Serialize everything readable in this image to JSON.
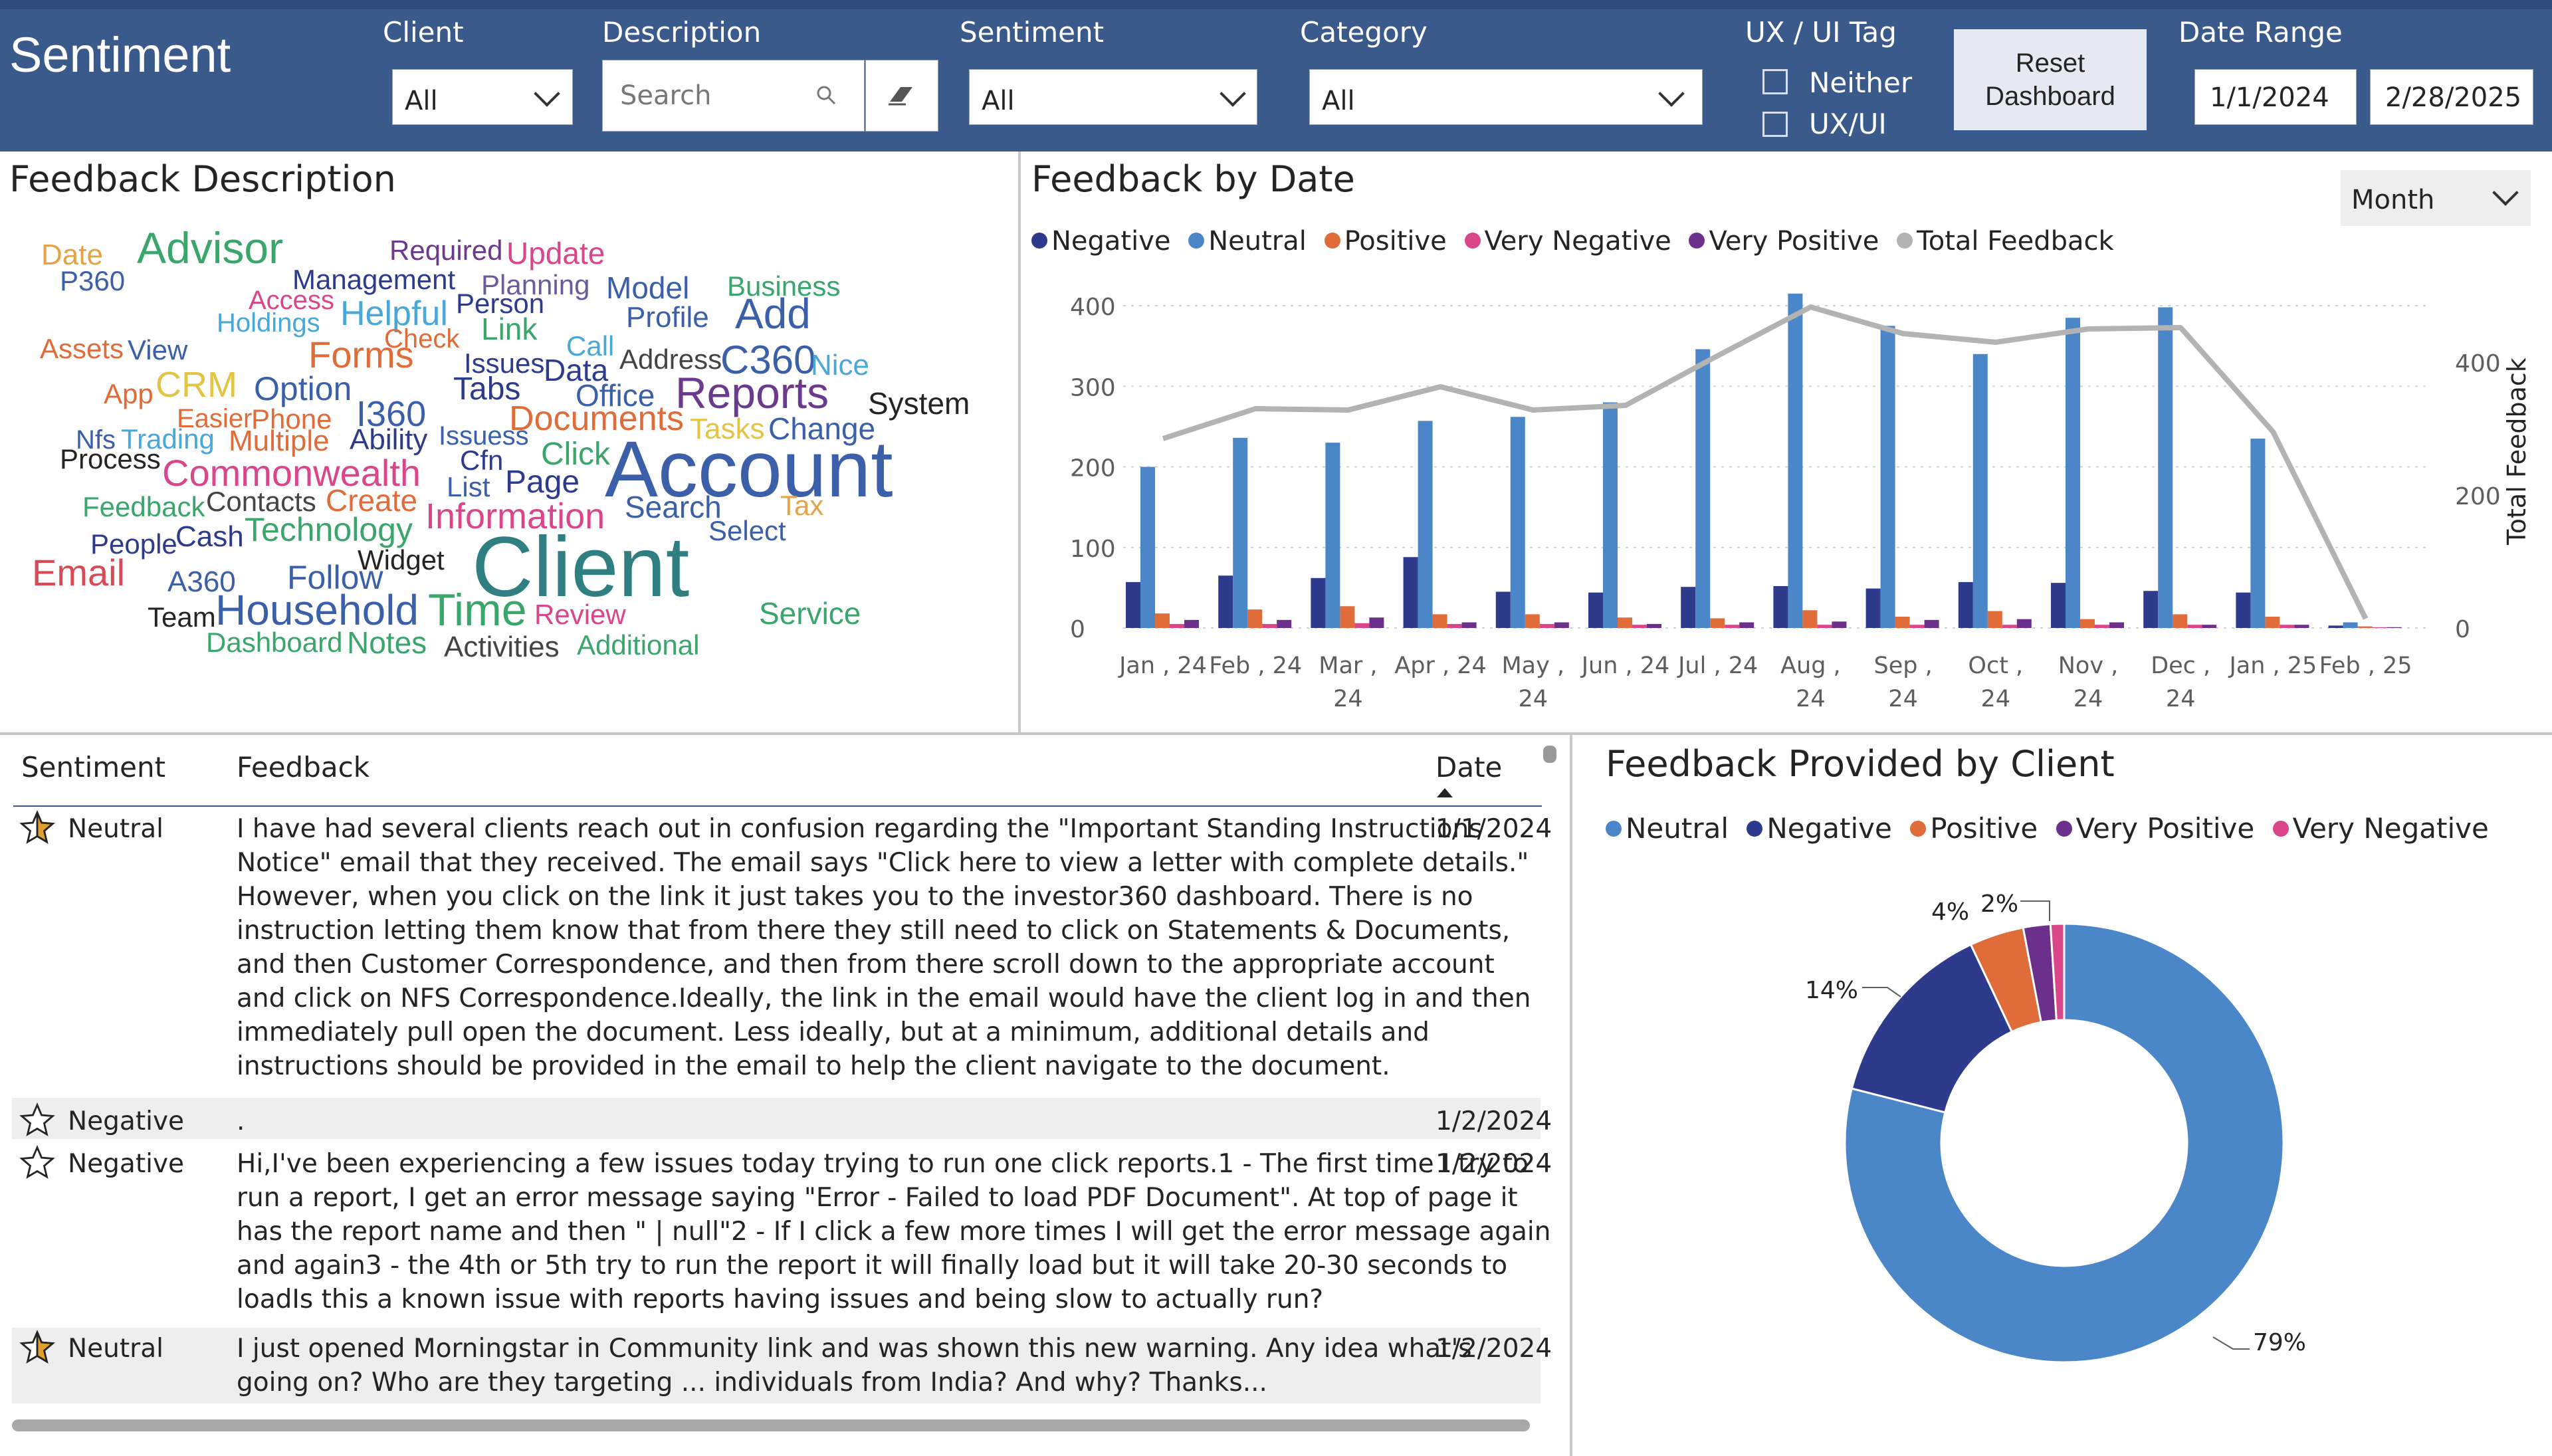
{
  "header": {
    "title": "Sentiment",
    "client_label": "Client",
    "client_value": "All",
    "description_label": "Description",
    "search_placeholder": "Search",
    "sentiment_label": "Sentiment",
    "sentiment_value": "All",
    "category_label": "Category",
    "category_value": "All",
    "uxui_label": "UX / UI Tag",
    "uxui_options": [
      "Neither",
      "UX/UI"
    ],
    "reset_label_line1": "Reset",
    "reset_label_line2": "Dashboard",
    "date_range_label": "Date Range",
    "date_start": "1/1/2024",
    "date_end": "2/28/2025"
  },
  "colors": {
    "header_bg": "#3b5a8c",
    "negative": "#2e3a8c",
    "neutral": "#4a86c8",
    "positive": "#e06c3a",
    "very_negative": "#d9468a",
    "very_positive": "#6b2f8c",
    "total": "#b3b3b3"
  },
  "word_cloud": {
    "title": "Feedback Description",
    "words": [
      "Date",
      "Advisor",
      "Required",
      "Update",
      "P360",
      "Management",
      "Planning",
      "Model",
      "Business",
      "Access",
      "Person",
      "Holdings",
      "Helpful",
      "Profile",
      "Add",
      "Check",
      "Link",
      "Assets",
      "View",
      "Forms",
      "Call",
      "Issues",
      "Data",
      "Address",
      "C360",
      "Nice",
      "App",
      "CRM",
      "Option",
      "Tabs",
      "Office",
      "Reports",
      "System",
      "Easier",
      "Phone",
      "I360",
      "Documents",
      "Nfs",
      "Trading",
      "Multiple",
      "Ability",
      "Issuess",
      "Tasks",
      "Change",
      "Process",
      "Cfn",
      "Click",
      "Account",
      "Commonwealth",
      "Feedback",
      "Contacts",
      "Create",
      "List",
      "Page",
      "Tax",
      "Search",
      "People",
      "Cash",
      "Technology",
      "Information",
      "Select",
      "Client",
      "Email",
      "Widget",
      "A360",
      "Follow",
      "Team",
      "Household",
      "Time",
      "Review",
      "Service",
      "Dashboard",
      "Notes",
      "Activities",
      "Additional"
    ]
  },
  "by_date": {
    "title": "Feedback by Date",
    "granularity": "Month",
    "legend": [
      "Negative",
      "Neutral",
      "Positive",
      "Very Negative",
      "Very Positive",
      "Total Feedback"
    ],
    "y2_label": "Total Feedback"
  },
  "chart_data": [
    {
      "type": "bar",
      "categories": [
        "Jan , 24",
        "Feb , 24",
        "Mar , 24",
        "Apr , 24",
        "May , 24",
        "Jun , 24",
        "Jul , 24",
        "Aug , 24",
        "Sep , 24",
        "Oct , 24",
        "Nov , 24",
        "Dec , 24",
        "Jan , 25",
        "Feb , 25"
      ],
      "series": [
        {
          "name": "Negative",
          "values": [
            57,
            65,
            62,
            88,
            45,
            44,
            51,
            52,
            49,
            57,
            56,
            46,
            44,
            3
          ]
        },
        {
          "name": "Neutral",
          "values": [
            200,
            236,
            230,
            257,
            262,
            280,
            346,
            415,
            375,
            340,
            385,
            398,
            235,
            7
          ]
        },
        {
          "name": "Positive",
          "values": [
            18,
            23,
            27,
            17,
            17,
            13,
            12,
            22,
            14,
            21,
            11,
            17,
            14,
            2
          ]
        },
        {
          "name": "Very Negative",
          "values": [
            5,
            5,
            6,
            5,
            5,
            4,
            4,
            4,
            4,
            4,
            4,
            4,
            4,
            1
          ]
        },
        {
          "name": "Very Positive",
          "values": [
            10,
            10,
            13,
            7,
            7,
            5,
            7,
            8,
            10,
            11,
            7,
            4,
            4,
            1
          ]
        }
      ],
      "line_series": {
        "name": "Total Feedback",
        "values": [
          285,
          330,
          328,
          363,
          328,
          335,
          410,
          483,
          443,
          430,
          450,
          452,
          295,
          14
        ]
      },
      "ylim": [
        0,
        420
      ],
      "y_ticks": [
        0,
        100,
        200,
        300,
        400
      ],
      "y2lim": [
        0,
        504
      ],
      "y2_ticks": [
        0,
        200,
        400
      ],
      "ylabel": "",
      "y2label": "Total Feedback",
      "legend_position": "top-left",
      "grid": true
    },
    {
      "type": "pie",
      "title": "Feedback Provided by Client",
      "labels": [
        "Neutral",
        "Negative",
        "Positive",
        "Very Positive",
        "Very Negative"
      ],
      "values": [
        79,
        14,
        4,
        2,
        1
      ],
      "data_labels": [
        "79%",
        "14%",
        "4%",
        "2%"
      ],
      "legend_position": "top"
    }
  ],
  "table": {
    "col_sentiment": "Sentiment",
    "col_feedback": "Feedback",
    "col_date": "Date",
    "rows": [
      {
        "sentiment": "Neutral",
        "date": "1/1/2024",
        "lines": [
          "I have had several clients reach out in confusion regarding the \"Important Standing Instructions",
          "Notice\" email that they received. The email says \"Click here to view a letter with complete details.\"",
          "However, when you click on the link it just takes you to the investor360 dashboard. There is no",
          "instruction letting them know that from there they still need to click on Statements & Documents,",
          "and then Customer Correspondence, and then from there scroll down to the appropriate account",
          "and click on NFS Correspondence.Ideally, the link in the email would have the client log in and then",
          "immediately pull open the document. Less ideally, but at a minimum, additional details and",
          "instructions should be provided in the email to help the client navigate to the document."
        ]
      },
      {
        "sentiment": "Negative",
        "date": "1/2/2024",
        "lines": [
          "."
        ]
      },
      {
        "sentiment": "Negative",
        "date": "1/2/2024",
        "lines": [
          "Hi,I've been experiencing a few issues today trying to run one click reports.1 - The first time I try to",
          "run a report, I get an error message saying \"Error - Failed to load PDF Document\". At top of page it",
          "has the report name and then \" | null\"2 - If I click a few more times I will get the error message again",
          "and again3 - the 4th or 5th try to run the report it will finally load but it will take 20-30 seconds to",
          "loadIs this a known issue with reports having issues and being slow to actually run?"
        ]
      },
      {
        "sentiment": "Neutral",
        "date": "1/2/2024",
        "lines": [
          "I just opened Morningstar in Community link and was shown this new warning. Any idea what's",
          "going on? Who are they targeting ... individuals from India? And why? Thanks..."
        ]
      }
    ]
  }
}
